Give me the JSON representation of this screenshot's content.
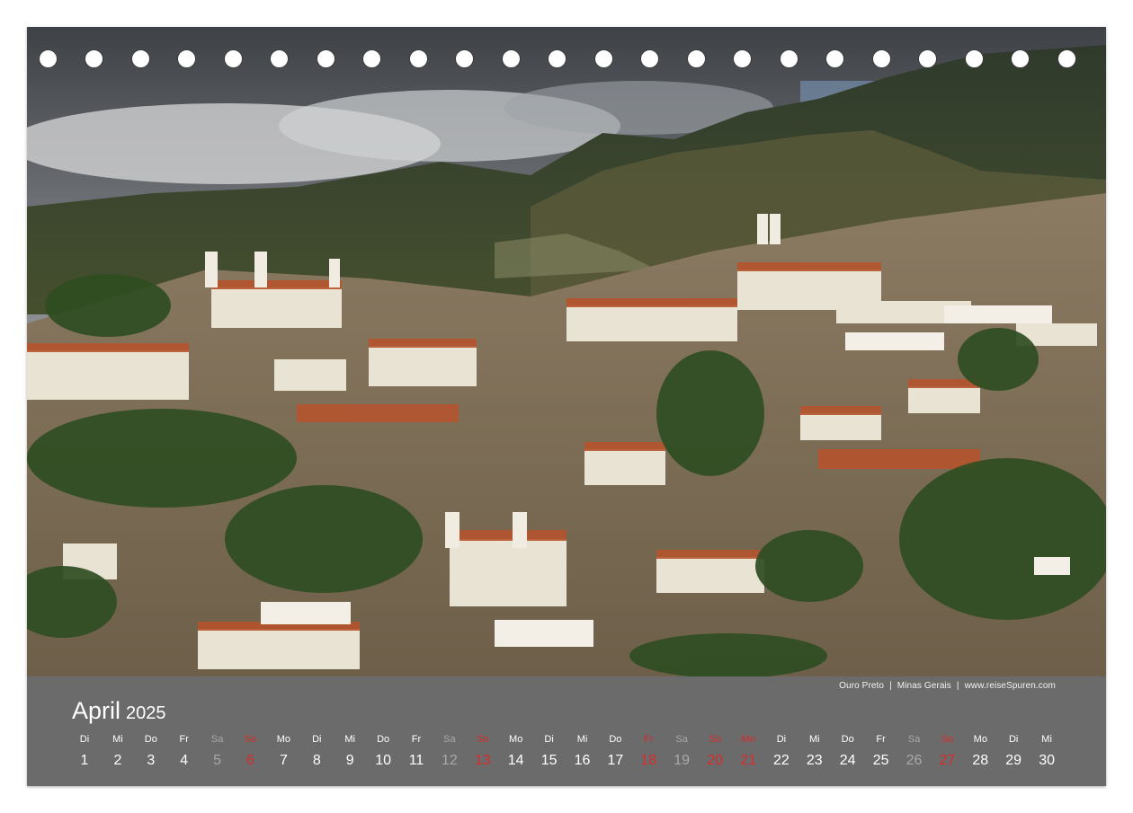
{
  "photo": {
    "icon": "townscape-photo"
  },
  "caption": {
    "place": "Ouro Preto",
    "region": "Minas Gerais",
    "site": "www.reiseSpuren.com",
    "separator": "|"
  },
  "month": {
    "name": "April",
    "year": "2025"
  },
  "colors": {
    "panel": "#6b6b6b",
    "text": "#ffffff",
    "saturday": "#a9a9a9",
    "holiday": "#d92b2b"
  },
  "days": [
    {
      "dow": "Di",
      "num": "1",
      "kind": "normal"
    },
    {
      "dow": "Mi",
      "num": "2",
      "kind": "normal"
    },
    {
      "dow": "Do",
      "num": "3",
      "kind": "normal"
    },
    {
      "dow": "Fr",
      "num": "4",
      "kind": "normal"
    },
    {
      "dow": "Sa",
      "num": "5",
      "kind": "sat"
    },
    {
      "dow": "So",
      "num": "6",
      "kind": "red"
    },
    {
      "dow": "Mo",
      "num": "7",
      "kind": "normal"
    },
    {
      "dow": "Di",
      "num": "8",
      "kind": "normal"
    },
    {
      "dow": "Mi",
      "num": "9",
      "kind": "normal"
    },
    {
      "dow": "Do",
      "num": "10",
      "kind": "normal"
    },
    {
      "dow": "Fr",
      "num": "11",
      "kind": "normal"
    },
    {
      "dow": "Sa",
      "num": "12",
      "kind": "sat"
    },
    {
      "dow": "So",
      "num": "13",
      "kind": "red"
    },
    {
      "dow": "Mo",
      "num": "14",
      "kind": "normal"
    },
    {
      "dow": "Di",
      "num": "15",
      "kind": "normal"
    },
    {
      "dow": "Mi",
      "num": "16",
      "kind": "normal"
    },
    {
      "dow": "Do",
      "num": "17",
      "kind": "normal"
    },
    {
      "dow": "Fr",
      "num": "18",
      "kind": "red"
    },
    {
      "dow": "Sa",
      "num": "19",
      "kind": "sat"
    },
    {
      "dow": "So",
      "num": "20",
      "kind": "red"
    },
    {
      "dow": "Mo",
      "num": "21",
      "kind": "red"
    },
    {
      "dow": "Di",
      "num": "22",
      "kind": "normal"
    },
    {
      "dow": "Mi",
      "num": "23",
      "kind": "normal"
    },
    {
      "dow": "Do",
      "num": "24",
      "kind": "normal"
    },
    {
      "dow": "Fr",
      "num": "25",
      "kind": "normal"
    },
    {
      "dow": "Sa",
      "num": "26",
      "kind": "sat"
    },
    {
      "dow": "So",
      "num": "27",
      "kind": "red"
    },
    {
      "dow": "Mo",
      "num": "28",
      "kind": "normal"
    },
    {
      "dow": "Di",
      "num": "29",
      "kind": "normal"
    },
    {
      "dow": "Mi",
      "num": "30",
      "kind": "normal"
    }
  ]
}
